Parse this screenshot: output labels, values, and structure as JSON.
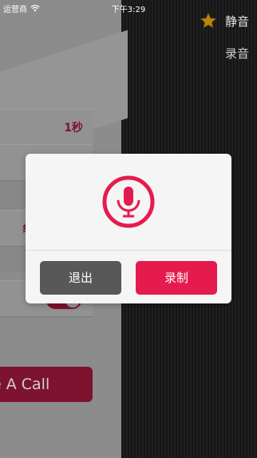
{
  "status_bar": {
    "carrier": "运营商",
    "time": "下午3:29"
  },
  "side_menu": {
    "items": [
      {
        "label": "静音",
        "icon": "star-icon"
      },
      {
        "label": "录音"
      }
    ]
  },
  "main": {
    "rows": [
      {
        "value": "1秒"
      },
      {
        "value": ""
      },
      {
        "value": "纟"
      }
    ],
    "toggle_on": true,
    "call_button_label": "e A Call"
  },
  "dialog": {
    "icon": "microphone-icon",
    "exit_label": "退出",
    "record_label": "录制"
  },
  "colors": {
    "accent": "#e61b4d",
    "exit_button": "#585858",
    "dialog_bg": "#f5f5f5"
  }
}
